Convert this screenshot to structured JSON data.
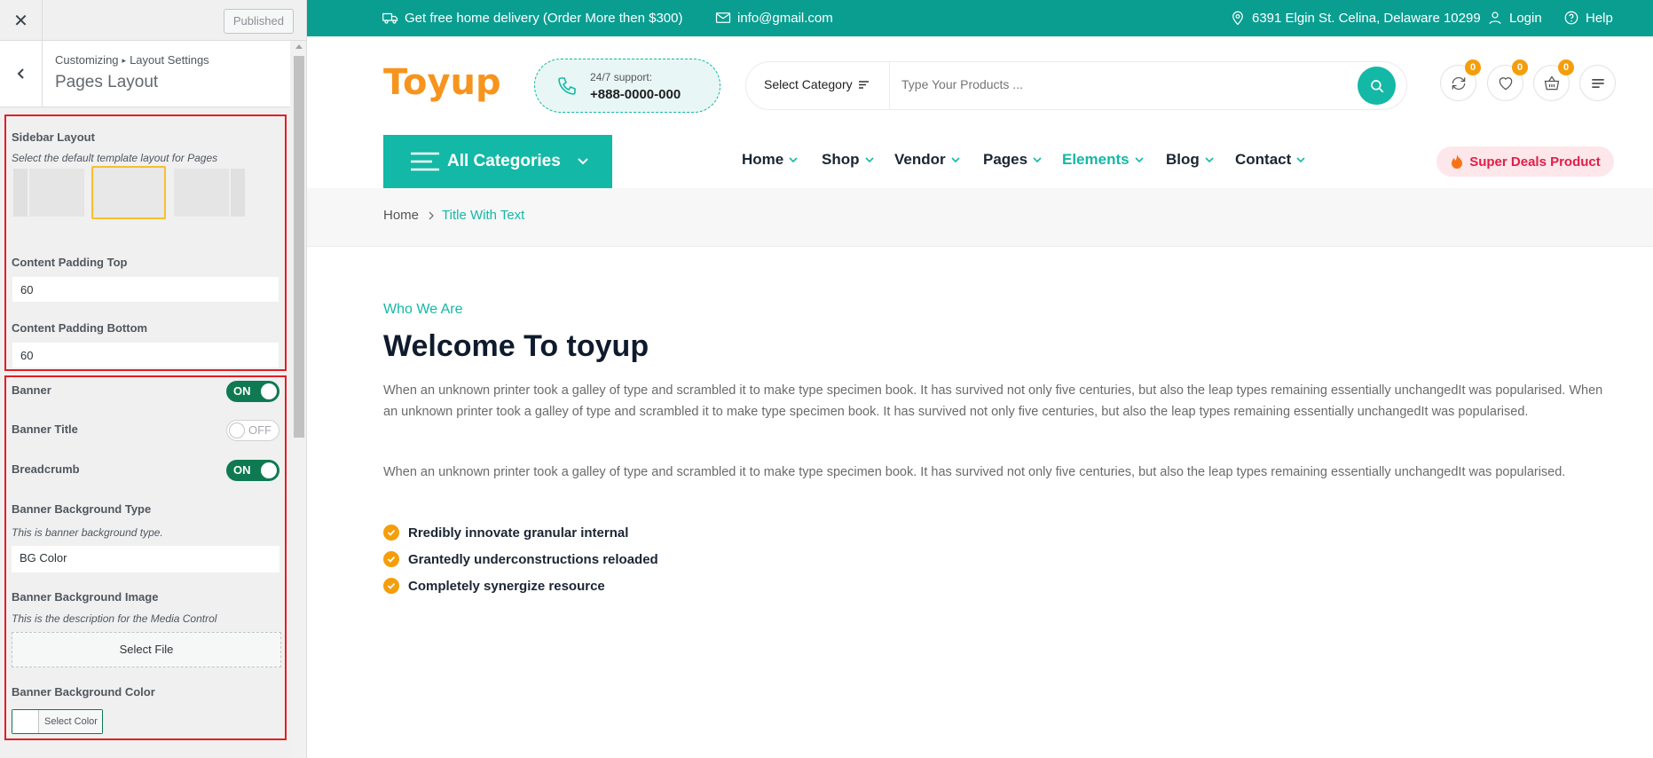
{
  "customizer": {
    "published": "Published",
    "breadcrumb_root": "Customizing",
    "breadcrumb_section": "Layout Settings",
    "title": "Pages Layout",
    "sidebar_layout": {
      "label": "Sidebar Layout",
      "description": "Select the default template layout for Pages",
      "selected_option": 2
    },
    "padding_top": {
      "label": "Content Padding Top",
      "value": "60"
    },
    "padding_bottom": {
      "label": "Content Padding Bottom",
      "value": "60"
    },
    "banner": {
      "label": "Banner",
      "state": "ON"
    },
    "banner_title": {
      "label": "Banner Title",
      "state": "OFF"
    },
    "breadcrumb": {
      "label": "Breadcrumb",
      "state": "ON"
    },
    "banner_bg_type": {
      "label": "Banner Background Type",
      "description": "This is banner background type.",
      "value": "BG Color"
    },
    "banner_bg_image": {
      "label": "Banner Background Image",
      "description": "This is the description for the Media Control",
      "button": "Select File"
    },
    "banner_bg_color": {
      "label": "Banner Background Color",
      "button": "Select Color"
    }
  },
  "site": {
    "topbar": {
      "delivery": "Get free home delivery (Order More then $300)",
      "email": "info@gmail.com",
      "address": "6391 Elgin St. Celina, Delaware 10299",
      "login": "Login",
      "help": "Help"
    },
    "logo": "Toyup",
    "support": {
      "label": "24/7 support:",
      "phone": "+888-0000-000"
    },
    "search": {
      "category": "Select Category",
      "placeholder": "Type Your Products ..."
    },
    "badges": {
      "compare": "0",
      "wishlist": "0",
      "cart": "0"
    },
    "all_categories": "All Categories",
    "nav": [
      "Home",
      "Shop",
      "Vendor",
      "Pages",
      "Elements",
      "Blog",
      "Contact"
    ],
    "deals": "Super Deals Product",
    "breadcrumb": {
      "home": "Home",
      "current": "Title With Text"
    },
    "content": {
      "subtitle": "Who We Are",
      "heading": "Welcome To toyup",
      "para1": "When an unknown printer took a galley of type and scrambled it to make type specimen book. It has survived not only five centuries, but also the leap types remaining essentially unchangedIt was popularised. When an unknown printer took a galley of type and scrambled it to make type specimen book. It has survived not only five centuries, but also the leap types remaining essentially unchangedIt was popularised.",
      "para2": "When an unknown printer took a galley of type and scrambled it to make type specimen book. It has survived not only five centuries, but also the leap types remaining essentially unchangedIt was popularised.",
      "checklist": [
        "Rredibly innovate granular internal",
        "Grantedly underconstructions reloaded",
        "Completely synergize resource"
      ]
    }
  },
  "colors": {
    "teal": "#0a9e91",
    "accent": "#14b8a6",
    "orange": "#f59e0b",
    "toggle_on": "#0f7a52",
    "highlight": "#e31e24"
  }
}
